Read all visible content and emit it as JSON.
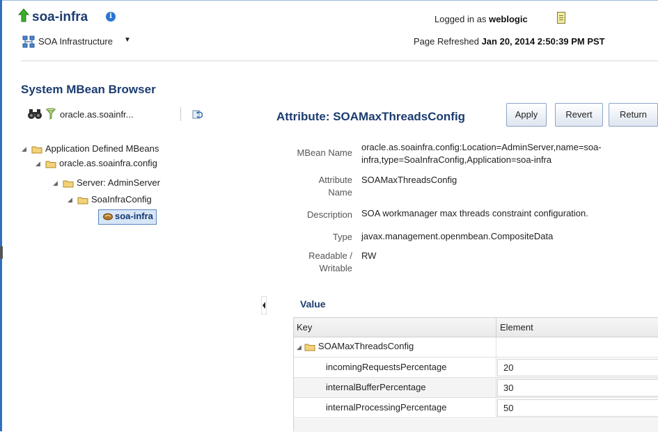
{
  "header": {
    "title": "soa-infra",
    "info_icon": "i",
    "nav_label": "SOA Infrastructure",
    "logged_prefix": "Logged in as",
    "user": "weblogic",
    "refreshed_prefix": "Page Refreshed",
    "refreshed_time": "Jan 20, 2014 2:50:39 PM PST"
  },
  "browser": {
    "title": "System MBean Browser",
    "breadcrumb": "oracle.as.soainfr...",
    "tree": [
      {
        "label": "Application Defined MBeans"
      },
      {
        "label": "oracle.as.soainfra.config"
      },
      {
        "label": "Server: AdminServer"
      },
      {
        "label": "SoaInfraConfig"
      },
      {
        "label": "soa-infra"
      }
    ]
  },
  "attribute": {
    "title": "Attribute: SOAMaxThreadsConfig",
    "buttons": {
      "apply": "Apply",
      "revert": "Revert",
      "return": "Return"
    },
    "props": {
      "mbean_name_label": "MBean Name",
      "mbean_name_line1": "oracle.as.soainfra.config:Location=AdminServer,name=soa-",
      "mbean_name_line2": "infra,type=SoaInfraConfig,Application=soa-infra",
      "attribute_label_1": "Attribute",
      "attribute_label_2": "Name",
      "attribute_value": "SOAMaxThreadsConfig",
      "description_label": "Description",
      "description_value": "SOA workmanager max threads constraint configuration.",
      "type_label": "Type",
      "type_value": "javax.management.openmbean.CompositeData",
      "rw_label_1": "Readable /",
      "rw_label_2": "Writable",
      "rw_value": "RW"
    },
    "value_title": "Value",
    "table": {
      "col_key": "Key",
      "col_element": "Element",
      "group": "SOAMaxThreadsConfig",
      "rows": [
        {
          "key": "incomingRequestsPercentage",
          "value": "20"
        },
        {
          "key": "internalBufferPercentage",
          "value": "30"
        },
        {
          "key": "internalProcessingPercentage",
          "value": "50"
        }
      ]
    }
  },
  "colors": {
    "title_blue": "#1b3c70",
    "selection_bg": "#d7e5f7",
    "folder_yellow": "#f2d27a"
  }
}
